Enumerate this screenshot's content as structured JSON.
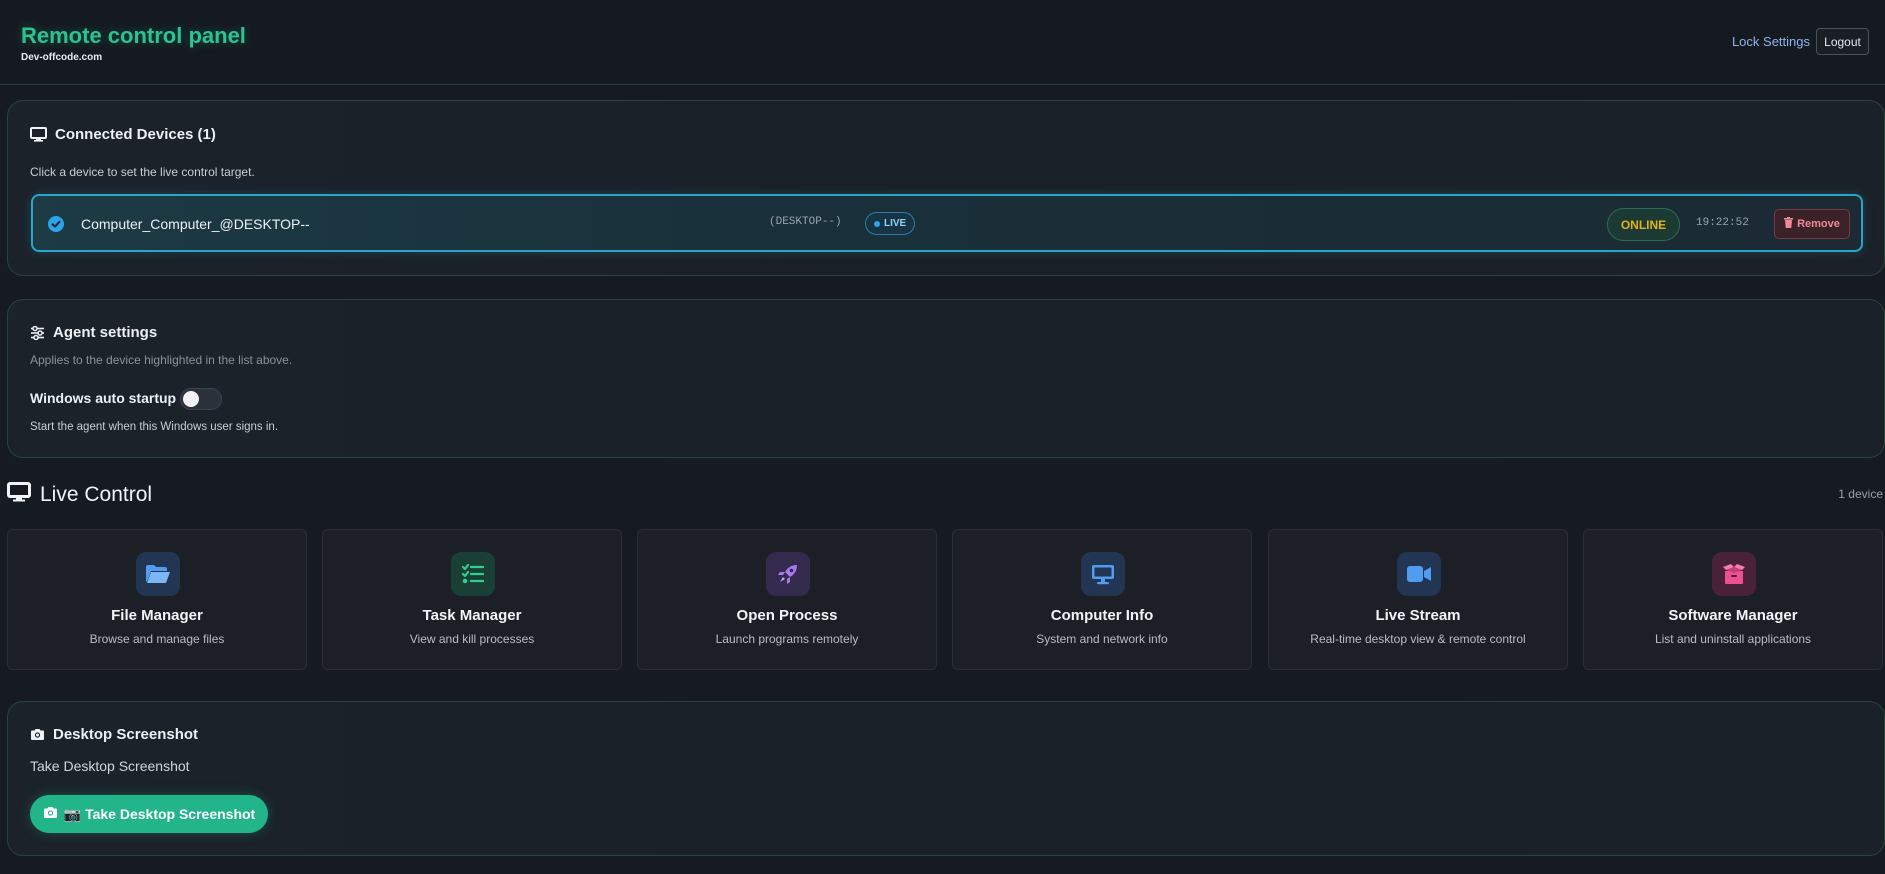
{
  "header": {
    "title": "Remote control panel",
    "subtitle": "Dev-offcode.com",
    "lock_settings": "Lock Settings",
    "logout": "Logout"
  },
  "devices": {
    "title": "Connected Devices (1)",
    "hint": "Click a device to set the live control target.",
    "items": [
      {
        "name": "Computer_Computer_@DESKTOP--",
        "host": "(DESKTOP--)",
        "live": "LIVE",
        "status": "ONLINE",
        "time": "19:22:52",
        "remove": "Remove"
      }
    ]
  },
  "agent": {
    "title": "Agent settings",
    "hint": "Applies to the device highlighted in the list above.",
    "toggle_label": "Windows auto startup",
    "toggle_on": false,
    "toggle_desc": "Start the agent when this Windows user signs in."
  },
  "live_control": {
    "title": "Live Control",
    "count": "1 device",
    "cards": [
      {
        "title": "File Manager",
        "desc": "Browse and manage files",
        "icon": "folder-icon",
        "color": "#4f9cf0"
      },
      {
        "title": "Task Manager",
        "desc": "View and kill processes",
        "icon": "task-list-icon",
        "color": "#2fd08f"
      },
      {
        "title": "Open Process",
        "desc": "Launch programs remotely",
        "icon": "rocket-icon",
        "color": "#a77bf0"
      },
      {
        "title": "Computer Info",
        "desc": "System and network info",
        "icon": "monitor-icon",
        "color": "#4f9cf0"
      },
      {
        "title": "Live Stream",
        "desc": "Real-time desktop view & remote control",
        "icon": "video-icon",
        "color": "#4f9cf0"
      },
      {
        "title": "Software Manager",
        "desc": "List and uninstall applications",
        "icon": "box-icon",
        "color": "#ee4f92"
      }
    ]
  },
  "screenshot": {
    "title": "Desktop Screenshot",
    "subtitle": "Take Desktop Screenshot",
    "button": "📷 Take Desktop Screenshot"
  }
}
